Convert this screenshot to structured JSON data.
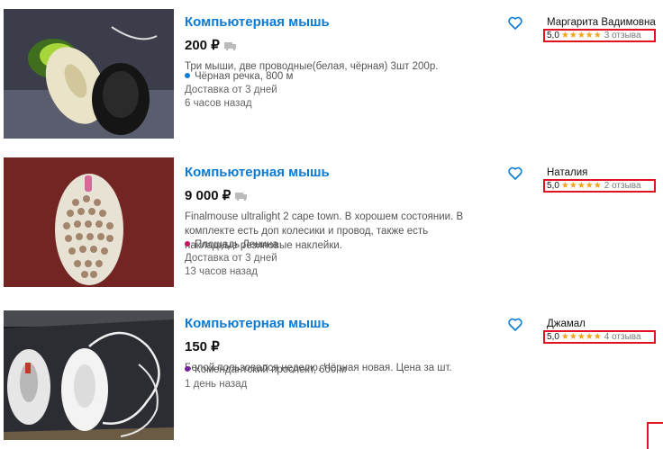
{
  "listings": [
    {
      "title": "Компьютерная мышь",
      "price": "200 ₽",
      "description": "Три мыши, две проводные(белая, чёрная) 3шт 200р.",
      "location": "Чёрная речка, 800 м",
      "location_dot_color": "#0a7bd6",
      "delivery": "Доставка от 3 дней",
      "posted": "6 часов назад",
      "seller": "Маргарита Вадимовна",
      "score": "5,0",
      "stars": "★★★★★",
      "reviews": "3 отзыва"
    },
    {
      "title": "Компьютерная мышь",
      "price": "9 000 ₽",
      "description": "Finalmouse ultralight 2 cape town. В хорошем состоянии. В комплекте есть доп колесики и провод, также есть накладные резиновые наклейки.",
      "location": "Площадь Ленина",
      "location_dot_color": "#c2185b",
      "delivery": "Доставка от 3 дней",
      "posted": "13 часов назад",
      "seller": "Наталия",
      "score": "5,0",
      "stars": "★★★★★",
      "reviews": "2 отзыва"
    },
    {
      "title": "Компьютерная мышь",
      "price": "150 ₽",
      "description": "Белой пользовался неделю. Чёрная новая. Цена за шт.",
      "location": "Комендантский проспект, 600 м",
      "location_dot_color": "#7b1fa2",
      "posted": "1 день назад",
      "seller": "Джамал",
      "score": "5,0",
      "stars": "★★★★★",
      "reviews": "4 отзыва"
    }
  ],
  "colors": {
    "link": "#0a7bd6",
    "highlight": "#e0131f",
    "star": "#f6a21a"
  },
  "icons": {
    "favorite": "heart-outline-icon",
    "delivery": "truck-icon"
  }
}
